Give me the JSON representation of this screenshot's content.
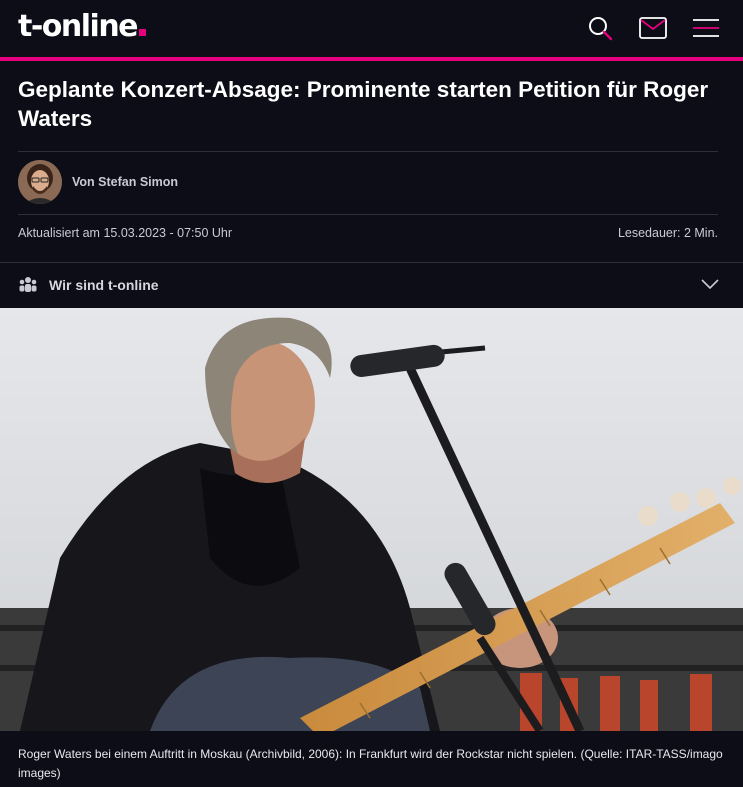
{
  "header": {
    "logo_text": "t-online",
    "brand_color": "#e6007e",
    "icons": [
      "search-icon",
      "mail-icon",
      "menu-icon"
    ]
  },
  "article": {
    "headline": "Geplante Konzert-Absage: Prominente starten Petition für Roger Waters",
    "author": "Von Stefan Simon",
    "updated": "Aktualisiert am 15.03.2023 - 07:50 Uhr",
    "read_time": "Lesedauer: 2 Min."
  },
  "about": {
    "label": "Wir sind t-online",
    "icon": "people-icon",
    "chevron": "chevron-down-icon"
  },
  "photo": {
    "caption": "Roger Waters bei einem Auftritt in Moskau (Archivbild, 2006): In Frankfurt wird der Rockstar nicht spielen. (Quelle: ITAR-TASS/imago images)"
  }
}
